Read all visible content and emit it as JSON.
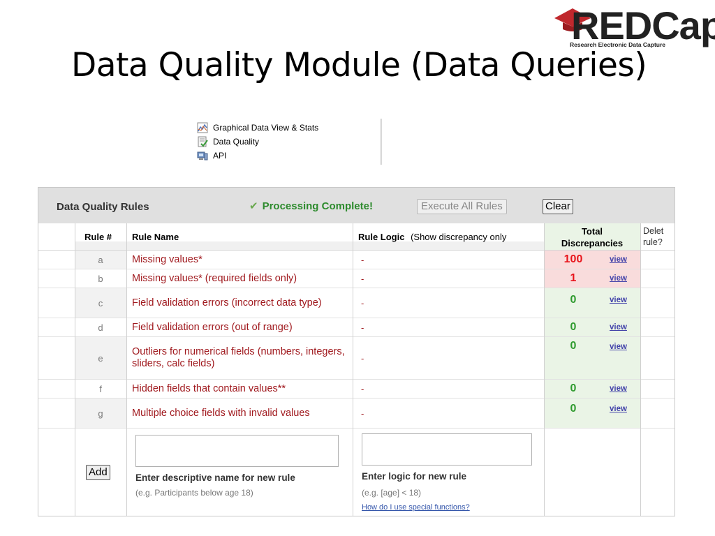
{
  "slide": {
    "title": "Data Quality Module (Data Queries)"
  },
  "logo": {
    "wordmark": "REDCap",
    "tagline": "Research Electronic Data Capture"
  },
  "menu": {
    "items": [
      {
        "label": "Graphical Data View & Stats",
        "icon": "chart-icon"
      },
      {
        "label": "Data Quality",
        "icon": "data-quality-icon"
      },
      {
        "label": "API",
        "icon": "api-icon"
      }
    ]
  },
  "panel": {
    "title": "Data Quality Rules",
    "status": "Processing Complete!",
    "execute_label": "Execute All Rules",
    "clear_label": "Clear"
  },
  "table": {
    "headers": {
      "rule_num": "Rule #",
      "rule_name": "Rule Name",
      "rule_logic": "Rule Logic",
      "rule_logic_sub": "(Show discrepancy only",
      "total_line1": "Total",
      "total_line2": "Discrepancies",
      "delete_line1": "Delet",
      "delete_line2": "rule?"
    },
    "rows": [
      {
        "num": "a",
        "name": "Missing values*",
        "logic": "-",
        "count": "100",
        "link": "view"
      },
      {
        "num": "b",
        "name": "Missing values* (required fields only)",
        "logic": "-",
        "count": "1",
        "link": "view"
      },
      {
        "num": "c",
        "name": "Field validation errors (incorrect data type)",
        "logic": "-",
        "count": "0",
        "link": "view"
      },
      {
        "num": "d",
        "name": "Field validation errors (out of range)",
        "logic": "-",
        "count": "0",
        "link": "view"
      },
      {
        "num": "e",
        "name": "Outliers for numerical fields (numbers, integers, sliders, calc fields)",
        "logic": "-",
        "count": "0",
        "link": "view"
      },
      {
        "num": "f",
        "name": "Hidden fields that contain values**",
        "logic": "-",
        "count": "0",
        "link": "view"
      },
      {
        "num": "g",
        "name": "Multiple choice fields with invalid values",
        "logic": "-",
        "count": "0",
        "link": "view"
      }
    ]
  },
  "add_rule": {
    "button_label": "Add",
    "name_value": "",
    "name_label": "Enter descriptive name for new rule",
    "name_hint": "(e.g. Participants below age 18)",
    "logic_value": "",
    "logic_label": "Enter logic for new rule",
    "logic_hint": "(e.g. [age] < 18)",
    "help_link": "How do I use special functions?"
  },
  "colors": {
    "rule_name": "#a0191e",
    "count_error": "#e8141b",
    "count_ok": "#2e9a2e",
    "status_green": "#2e8b2e",
    "discrepancy_bg": "#eaf4e6",
    "error_bg": "#f9dcdc"
  }
}
